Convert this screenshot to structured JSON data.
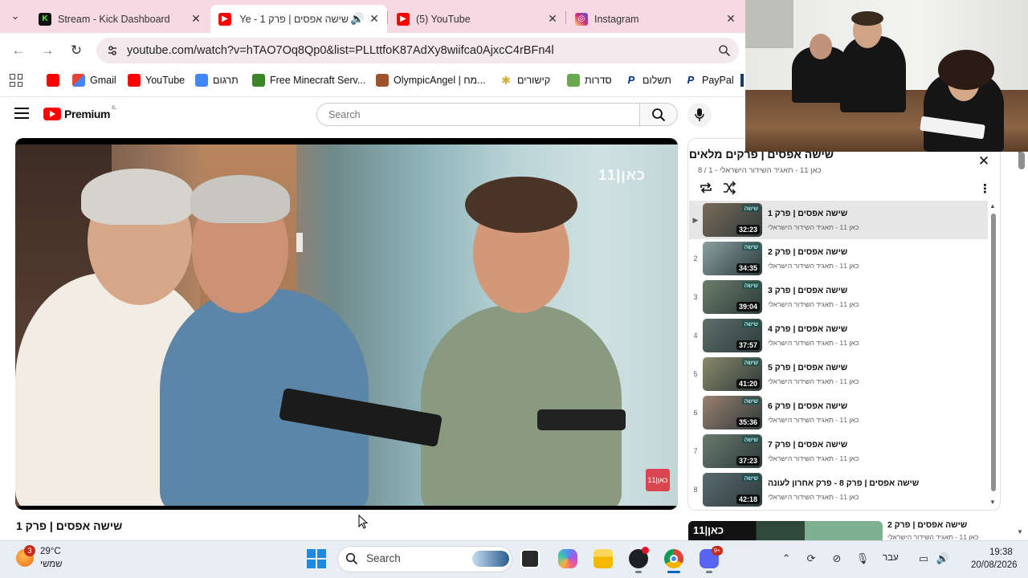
{
  "browser": {
    "tabs": [
      {
        "title": "Stream - Kick Dashboard",
        "favicon": "kick-icon",
        "color": "#53fc18"
      },
      {
        "title": "שישה אפסים | פרק 1 - Ye",
        "favicon": "youtube-icon",
        "color": "#ff0000",
        "active": true
      },
      {
        "title": "(5) YouTube",
        "favicon": "youtube-icon",
        "color": "#ff0000"
      },
      {
        "title": "Instagram",
        "favicon": "instagram-icon",
        "color": "#d62976"
      }
    ],
    "url": "youtube.com/watch?v=hTAO7Oq8Qp0&list=PLLttfoK87AdXy8wiifca0AjxcC4rBFn4l",
    "bookmarks": [
      {
        "label": "",
        "icon": "youtube-icon",
        "color": "#ff0000"
      },
      {
        "label": "Gmail",
        "icon": "gmail-icon",
        "color": "#ea4335"
      },
      {
        "label": "YouTube",
        "icon": "youtube-icon",
        "color": "#ff0000"
      },
      {
        "label": "תרגום",
        "icon": "translate-icon",
        "color": "#4285f4"
      },
      {
        "label": "Free Minecraft Serv...",
        "icon": "minecraft-icon",
        "color": "#3c8527"
      },
      {
        "label": "OlympicAngel | מח...",
        "icon": "avatar-icon",
        "color": "#a0522d"
      },
      {
        "label": "קישורים",
        "icon": "star-icon",
        "color": "#d4af37"
      },
      {
        "label": "סדרות",
        "icon": "tv-icon",
        "color": "#6aa84f"
      },
      {
        "label": "תשלום",
        "icon": "paypal-icon",
        "color": "#003087"
      },
      {
        "label": "PayPal",
        "icon": "paypal-icon",
        "color": "#003087"
      }
    ]
  },
  "youtube": {
    "logo_text": "Premium",
    "country_code": "IL",
    "search_placeholder": "Search",
    "video_title": "שישה אפסים | פרק 1",
    "video_overlay_logo": "כאן|11",
    "video_corner_badge": "כאן|11"
  },
  "playlist": {
    "title": "שישה אפסים | פרקים מלאים",
    "subtitle": "כאן 11 - תאגיד השידור הישראלי - 1 / 8",
    "items": [
      {
        "index": "▶",
        "title": "שישה אפסים | פרק 1",
        "channel": "כאן 11 - תאגיד השידור הישראלי",
        "duration": "32:23",
        "thumb_label": "שישה",
        "current": true
      },
      {
        "index": "2",
        "title": "שישה אפסים | פרק 2",
        "channel": "כאן 11 - תאגיד השידור הישראלי",
        "duration": "34:35",
        "thumb_label": "שישה"
      },
      {
        "index": "3",
        "title": "שישה אפסים | פרק 3",
        "channel": "כאן 11 - תאגיד השידור הישראלי",
        "duration": "39:04",
        "thumb_label": "שישה"
      },
      {
        "index": "4",
        "title": "שישה אפסים | פרק 4",
        "channel": "כאן 11 - תאגיד השידור הישראלי",
        "duration": "37:57",
        "thumb_label": "שישה"
      },
      {
        "index": "5",
        "title": "שישה אפסים | פרק 5",
        "channel": "כאן 11 - תאגיד השידור הישראלי",
        "duration": "41:20",
        "thumb_label": "שישה"
      },
      {
        "index": "6",
        "title": "שישה אפסים | פרק 6",
        "channel": "כאן 11 - תאגיד השידור הישראלי",
        "duration": "35:36",
        "thumb_label": "שישה"
      },
      {
        "index": "7",
        "title": "שישה אפסים | פרק 7",
        "channel": "כאן 11 - תאגיד השידור הישראלי",
        "duration": "37:23",
        "thumb_label": "שישה"
      },
      {
        "index": "8",
        "title": "שישה אפסים | פרק 8 - פרק אחרון לעונה",
        "channel": "כאן 11 - תאגיד השידור הישראלי",
        "duration": "42:18",
        "thumb_label": "שישה"
      }
    ]
  },
  "next_video": {
    "title": "שישה אפסים | פרק 2",
    "channel": "כאן 11 - תאגיד השידור הישראלי",
    "thumb_text": "כאן|11"
  },
  "taskbar": {
    "weather_temp": "29°C",
    "weather_condition": "שמשי",
    "weather_badge": "3",
    "search_label": "Search",
    "discord_badge": "9+",
    "language": "עבר",
    "time": "19:38",
    "date": "20/08/2026",
    "apps": [
      "task-view-icon",
      "copilot-icon",
      "file-explorer-icon",
      "github-icon",
      "chrome-icon",
      "discord-icon"
    ]
  }
}
